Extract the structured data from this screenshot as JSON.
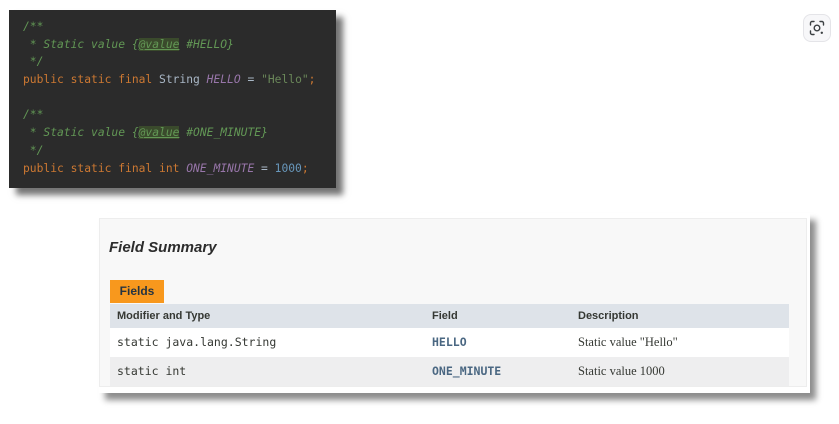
{
  "code": {
    "comment_open": "/**",
    "comment_close": " */",
    "line1_star": " * Static value {",
    "line1_tag": "@value",
    "line1_ref": " #HELLO}",
    "decl1": {
      "kw": "public static final ",
      "type": "String ",
      "name": "HELLO",
      "eq": " = ",
      "value": "\"Hello\"",
      "semi": ";"
    },
    "line2_star": " * Static value {",
    "line2_tag": "@value",
    "line2_ref": " #ONE_MINUTE}",
    "decl2": {
      "kw": "public static final int ",
      "name": "ONE_MINUTE",
      "eq": " = ",
      "value": "1000",
      "semi": ";"
    }
  },
  "summary": {
    "title": "Field Summary",
    "tab_label": "Fields",
    "columns": [
      "Modifier and Type",
      "Field",
      "Description"
    ],
    "rows": [
      {
        "modifier": "static java.lang.String",
        "field": "HELLO",
        "description": "Static value \"Hello\""
      },
      {
        "modifier": "static int",
        "field": "ONE_MINUTE",
        "description": "Static value 1000"
      }
    ]
  },
  "icons": {
    "lens": "google-lens-icon"
  }
}
